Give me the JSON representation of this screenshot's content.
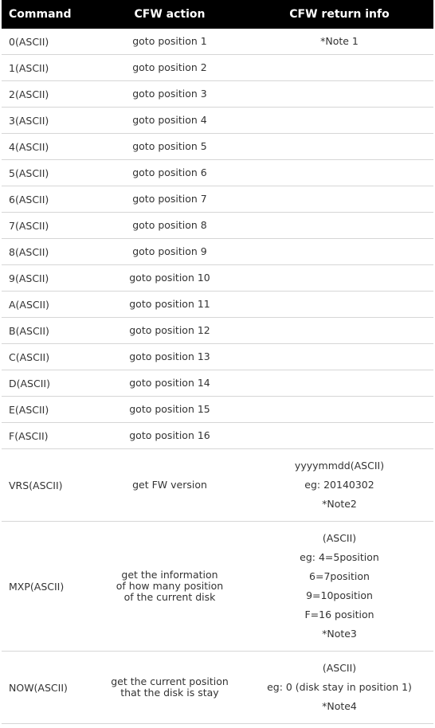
{
  "headers": [
    "Command",
    "CFW action",
    "CFW return info"
  ],
  "rows": [
    {
      "command": "0(ASCII)",
      "action": [
        "goto position 1"
      ],
      "info": [
        "*Note 1"
      ]
    },
    {
      "command": "1(ASCII)",
      "action": [
        "goto position 2"
      ],
      "info": []
    },
    {
      "command": "2(ASCII)",
      "action": [
        "goto position 3"
      ],
      "info": []
    },
    {
      "command": "3(ASCII)",
      "action": [
        "goto position 4"
      ],
      "info": []
    },
    {
      "command": "4(ASCII)",
      "action": [
        "goto position 5"
      ],
      "info": []
    },
    {
      "command": "5(ASCII)",
      "action": [
        "goto position 6"
      ],
      "info": []
    },
    {
      "command": "6(ASCII)",
      "action": [
        "goto position 7"
      ],
      "info": []
    },
    {
      "command": "7(ASCII)",
      "action": [
        "goto position 8"
      ],
      "info": []
    },
    {
      "command": "8(ASCII)",
      "action": [
        "goto position 9"
      ],
      "info": []
    },
    {
      "command": "9(ASCII)",
      "action": [
        "goto position 10"
      ],
      "info": []
    },
    {
      "command": "A(ASCII)",
      "action": [
        "goto position 11"
      ],
      "info": []
    },
    {
      "command": "B(ASCII)",
      "action": [
        "goto position 12"
      ],
      "info": []
    },
    {
      "command": "C(ASCII)",
      "action": [
        "goto position 13"
      ],
      "info": []
    },
    {
      "command": "D(ASCII)",
      "action": [
        "goto position 14"
      ],
      "info": []
    },
    {
      "command": "E(ASCII)",
      "action": [
        "goto position 15"
      ],
      "info": []
    },
    {
      "command": "F(ASCII)",
      "action": [
        "goto position 16"
      ],
      "info": []
    },
    {
      "command": "VRS(ASCII)",
      "action": [
        "get FW version"
      ],
      "info": [
        "yyyymmdd(ASCII)",
        "eg: 20140302",
        "*Note2"
      ]
    },
    {
      "command": "MXP(ASCII)",
      "action": [
        "get the information",
        "of how many position",
        "of the current disk"
      ],
      "info": [
        "(ASCII)",
        "eg: 4=5position",
        "6=7position",
        "9=10position",
        "F=16 position",
        "*Note3"
      ]
    },
    {
      "command": "NOW(ASCII)",
      "action": [
        "get the current position",
        "that the disk is stay"
      ],
      "info": [
        "(ASCII)",
        "eg: 0 (disk stay in position 1)",
        "*Note4"
      ]
    }
  ]
}
